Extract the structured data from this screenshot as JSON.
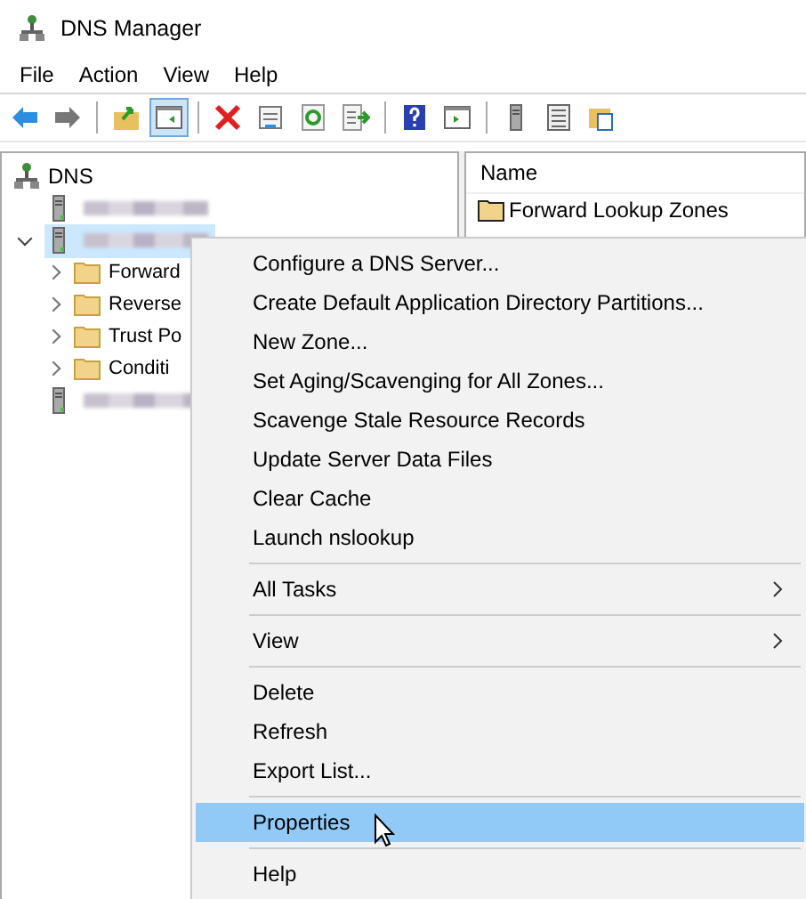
{
  "window": {
    "title": "DNS Manager"
  },
  "menu_bar": [
    "File",
    "Action",
    "View",
    "Help"
  ],
  "toolbar": [
    {
      "kind": "back"
    },
    {
      "kind": "forward"
    },
    {
      "kind": "separator"
    },
    {
      "kind": "up"
    },
    {
      "kind": "tree",
      "pressed": true
    },
    {
      "kind": "separator"
    },
    {
      "kind": "delete"
    },
    {
      "kind": "properties"
    },
    {
      "kind": "refresh"
    },
    {
      "kind": "export"
    },
    {
      "kind": "separator"
    },
    {
      "kind": "help"
    },
    {
      "kind": "pane"
    },
    {
      "kind": "separator"
    },
    {
      "kind": "server"
    },
    {
      "kind": "list"
    },
    {
      "kind": "folder"
    }
  ],
  "tree": {
    "label": "DNS",
    "children": [
      {
        "kind": "server",
        "selected": false
      },
      {
        "kind": "server",
        "selected": true,
        "expanded": true,
        "children": [
          {
            "kind": "folder",
            "label": "Forward",
            "expanded": false
          },
          {
            "kind": "folder",
            "label": "Reverse",
            "expanded": false
          },
          {
            "kind": "folder",
            "label": "Trust Po",
            "expanded": false
          },
          {
            "kind": "folder",
            "label": "Conditi",
            "expanded": false
          }
        ]
      },
      {
        "kind": "server",
        "selected": false
      }
    ]
  },
  "list": {
    "columns": [
      "Name"
    ],
    "rows": [
      "Forward Lookup Zones"
    ]
  },
  "context_menu": [
    {
      "kind": "item",
      "label": "Configure a DNS Server...",
      "selected": false
    },
    {
      "kind": "item",
      "label": "Create Default Application Directory Partitions...",
      "selected": false
    },
    {
      "kind": "item",
      "label": "New Zone...",
      "selected": false
    },
    {
      "kind": "item",
      "label": "Set Aging/Scavenging for All Zones...",
      "selected": false
    },
    {
      "kind": "item",
      "label": "Scavenge Stale Resource Records",
      "selected": false
    },
    {
      "kind": "item",
      "label": "Update Server Data Files",
      "selected": false
    },
    {
      "kind": "item",
      "label": "Clear Cache",
      "selected": false
    },
    {
      "kind": "item",
      "label": "Launch nslookup",
      "selected": false
    },
    {
      "kind": "separator"
    },
    {
      "kind": "submenu",
      "label": "All Tasks",
      "selected": false
    },
    {
      "kind": "separator"
    },
    {
      "kind": "submenu",
      "label": "View",
      "selected": false
    },
    {
      "kind": "separator"
    },
    {
      "kind": "item",
      "label": "Delete",
      "selected": false
    },
    {
      "kind": "item",
      "label": "Refresh",
      "selected": false
    },
    {
      "kind": "item",
      "label": "Export List...",
      "selected": false
    },
    {
      "kind": "separator"
    },
    {
      "kind": "item",
      "label": "Properties",
      "selected": true
    },
    {
      "kind": "separator"
    },
    {
      "kind": "item",
      "label": "Help",
      "selected": false
    }
  ]
}
